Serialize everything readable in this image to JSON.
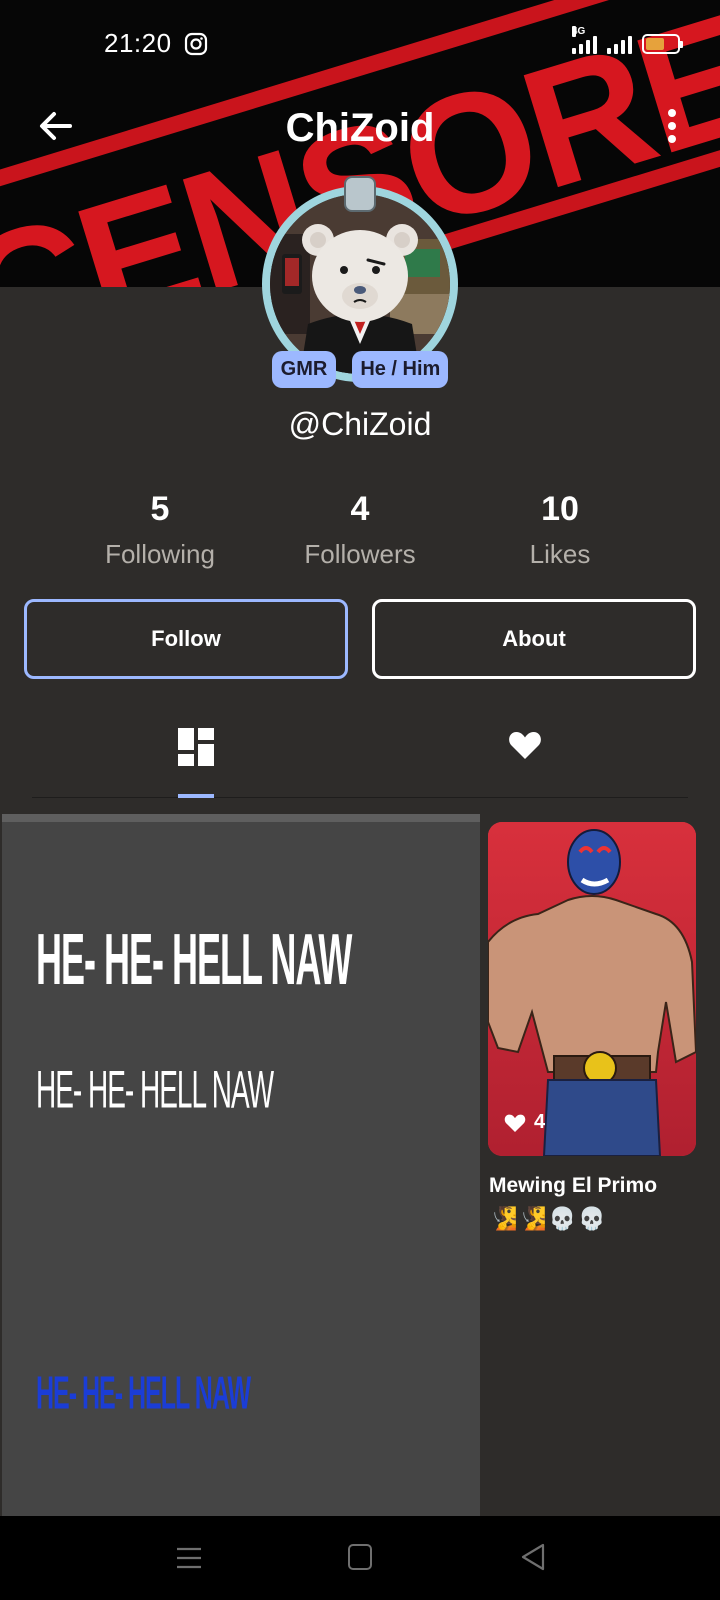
{
  "status_bar": {
    "time": "21:20",
    "network": "4G",
    "icons": [
      "instagram-icon",
      "signal-icon",
      "signal-icon",
      "battery-icon"
    ],
    "battery_color": "#e6a23c"
  },
  "banner": {
    "stamp_text": "CENSORED",
    "stamp_color": "#d6171f"
  },
  "app_bar": {
    "title": "ChiZoid",
    "back_icon": "arrow-left-icon",
    "menu_icon": "more-vertical-icon"
  },
  "profile": {
    "badges": [
      "GMR",
      "He / Him"
    ],
    "handle": "@ChiZoid",
    "badge_color": "#9cb8ff"
  },
  "stats": [
    {
      "value": "5",
      "label": "Following"
    },
    {
      "value": "4",
      "label": "Followers"
    },
    {
      "value": "10",
      "label": "Likes"
    }
  ],
  "actions": {
    "follow_label": "Follow",
    "about_label": "About"
  },
  "tabs": {
    "items": [
      "grid-icon",
      "heart-icon"
    ],
    "active": "grid-icon"
  },
  "posts": [
    {
      "lines": [
        "HE- HE- HELL NAW",
        "HE- HE- HELL NAW",
        "HE- HE- HELL NAW"
      ],
      "colors": [
        "#ffffff",
        "#ffffff",
        "#1b3dd6"
      ]
    },
    {
      "title": "Mewing El Primo",
      "likes": "4",
      "emojis": "🧏🧏💀💀"
    }
  ],
  "nav_bar": [
    "menu-icon",
    "home-icon",
    "back-icon"
  ]
}
